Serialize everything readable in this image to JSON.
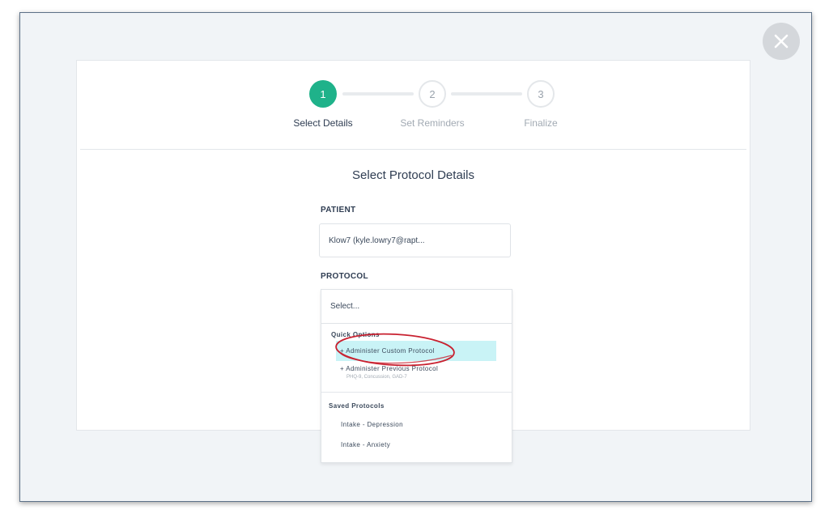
{
  "modal": {
    "close_icon": "close-icon"
  },
  "stepper": {
    "steps": [
      {
        "number": "1",
        "label": "Select Details",
        "state": "active"
      },
      {
        "number": "2",
        "label": "Set Reminders",
        "state": "inactive"
      },
      {
        "number": "3",
        "label": "Finalize",
        "state": "inactive"
      }
    ]
  },
  "form": {
    "title": "Select Protocol Details",
    "patient": {
      "label": "PATIENT",
      "value": "Klow7 (kyle.lowry7@rapt..."
    },
    "protocol": {
      "label": "PROTOCOL",
      "value": "Select..."
    }
  },
  "dropdown": {
    "quick_options_header": "Quick Options",
    "quick_options": [
      {
        "label": "+ Administer Custom Protocol",
        "highlighted": true
      },
      {
        "label": "+ Administer Previous Protocol",
        "sub": "PHQ-9, Concussion, GAD-7",
        "highlighted": false
      }
    ],
    "saved_header": "Saved Protocols",
    "saved": [
      {
        "label": "Intake - Depression"
      },
      {
        "label": "Intake - Anxiety"
      }
    ]
  },
  "colors": {
    "accent": "#1fb28a",
    "highlight": "#c9f3f6",
    "annotation": "#c8202f"
  }
}
